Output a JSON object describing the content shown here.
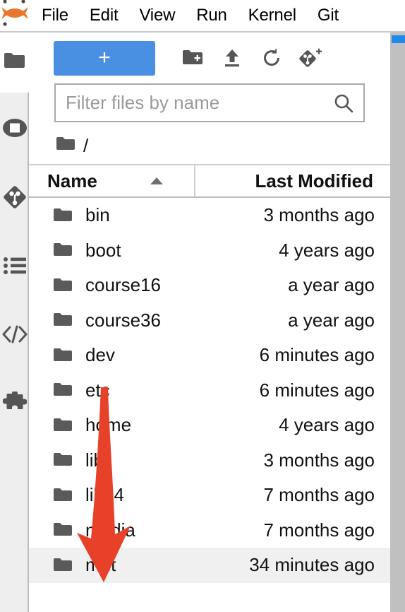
{
  "menubar": {
    "logo_name": "jupyter-logo",
    "items": [
      {
        "label": "File"
      },
      {
        "label": "Edit"
      },
      {
        "label": "View"
      },
      {
        "label": "Run"
      },
      {
        "label": "Kernel"
      },
      {
        "label": "Git"
      }
    ]
  },
  "activitybar": {
    "items": [
      {
        "name": "file-browser-icon",
        "label": "File Browser"
      },
      {
        "name": "running-terminals-icon",
        "label": "Running Terminals and Kernels"
      },
      {
        "name": "git-icon",
        "label": "Git"
      },
      {
        "name": "table-of-contents-icon",
        "label": "Table of Contents"
      },
      {
        "name": "code-snippets-icon",
        "label": "Code"
      },
      {
        "name": "extension-manager-icon",
        "label": "Extension Manager"
      }
    ]
  },
  "toolbar": {
    "new_launcher_label": "+",
    "new_folder_label": "New Folder",
    "upload_label": "Upload Files",
    "refresh_label": "Refresh File List",
    "new_checkpoint_label": "New Checkpoint"
  },
  "filter": {
    "placeholder": "Filter files by name",
    "value": ""
  },
  "breadcrumb": {
    "root_label": "/"
  },
  "columns": {
    "name_label": "Name",
    "modified_label": "Last Modified",
    "sort_direction": "ascending"
  },
  "files": [
    {
      "name": "bin",
      "modified": "3 months ago",
      "selected": false
    },
    {
      "name": "boot",
      "modified": "4 years ago",
      "selected": false
    },
    {
      "name": "course16",
      "modified": "a year ago",
      "selected": false
    },
    {
      "name": "course36",
      "modified": "a year ago",
      "selected": false
    },
    {
      "name": "dev",
      "modified": "6 minutes ago",
      "selected": false
    },
    {
      "name": "etc",
      "modified": "6 minutes ago",
      "selected": false
    },
    {
      "name": "home",
      "modified": "4 years ago",
      "selected": false
    },
    {
      "name": "lib",
      "modified": "3 months ago",
      "selected": false
    },
    {
      "name": "lib64",
      "modified": "7 months ago",
      "selected": false
    },
    {
      "name": "media",
      "modified": "7 months ago",
      "selected": false
    },
    {
      "name": "mnt",
      "modified": "34 minutes ago",
      "selected": true
    }
  ],
  "annotation": {
    "arrow_color": "#e8412a",
    "points_to": "mnt"
  },
  "colors": {
    "accent_blue": "#4a90e2",
    "panel_gray": "#eeeeee",
    "selected_row": "#f0f0f0",
    "icon_gray": "#5a5a5a"
  }
}
